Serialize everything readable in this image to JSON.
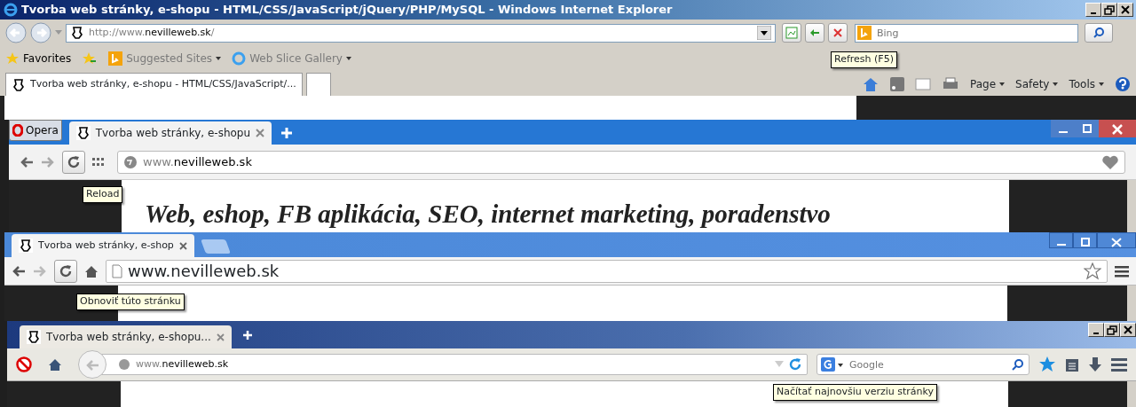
{
  "ie": {
    "title": "Tvorba web stránky, e-shopu - HTML/CSS/JavaScript/jQuery/PHP/MySQL - Windows Internet Explorer",
    "address": {
      "prefix": "http://www.",
      "domain": "nevilleweb.sk",
      "suffix": "/"
    },
    "search": {
      "placeholder": "Bing"
    },
    "tooltip": "Refresh (F5)",
    "favorites": [
      {
        "label": "Favorites",
        "kind": "star"
      },
      {
        "label": "Suggested Sites",
        "kind": "menu"
      },
      {
        "label": "Web Slice Gallery",
        "kind": "menu"
      }
    ],
    "tab": "Tvorba web stránky, e-shopu - HTML/CSS/JavaScript/...",
    "command_menus": [
      "Page",
      "Safety",
      "Tools"
    ]
  },
  "opera": {
    "menu_label": "Opera",
    "tab": "Tvorba web stránky, e-shopu",
    "address": {
      "prefix": "www.",
      "domain": "nevilleweb.sk"
    },
    "tooltip": "Reload",
    "heading": "Web, eshop, FB aplikácia, SEO, internet marketing, poradenstvo"
  },
  "chrome": {
    "tab": "Tvorba web stránky, e-shop",
    "address": "www.nevilleweb.sk",
    "tooltip": "Obnoviť túto stránku"
  },
  "firefox": {
    "tab": "Tvorba web stránky, e-shopu...",
    "address": {
      "prefix": "www.",
      "domain": "nevilleweb.sk"
    },
    "search": {
      "placeholder": "Google"
    },
    "tooltip": "Načítať najnovšiu verziu stránky"
  }
}
